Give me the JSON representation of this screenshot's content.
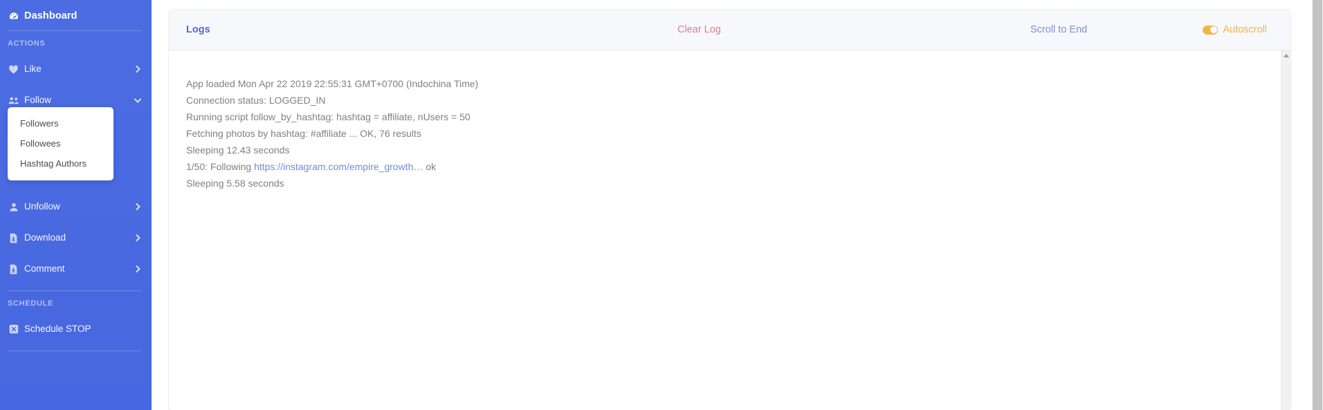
{
  "sidebar": {
    "brand": {
      "label": "Dashboard",
      "icon": "tachometer-icon"
    },
    "sections": [
      {
        "label": "ACTIONS"
      },
      {
        "label": "SCHEDULE"
      }
    ],
    "items": [
      {
        "label": "Like",
        "icon": "heart-icon",
        "chevron": "chevron-right-icon"
      },
      {
        "label": "Follow",
        "icon": "users-icon",
        "chevron": "chevron-down-icon"
      },
      {
        "label": "Unfollow",
        "icon": "user-icon",
        "chevron": "chevron-right-icon"
      },
      {
        "label": "Download",
        "icon": "file-download-icon",
        "chevron": "chevron-right-icon"
      },
      {
        "label": "Comment",
        "icon": "file-download-icon",
        "chevron": "chevron-right-icon"
      }
    ],
    "submenu": [
      {
        "label": "Followers"
      },
      {
        "label": "Followees"
      },
      {
        "label": "Hashtag Authors"
      }
    ],
    "schedule": {
      "label": "Schedule STOP",
      "icon": "x-square-icon"
    },
    "colors": {
      "background": "#4a6ae0",
      "text": "#ffffff"
    }
  },
  "header": {
    "title": "Logs",
    "clear_label": "Clear Log",
    "scroll_label": "Scroll to End",
    "autoscroll_label": "Autoscroll",
    "autoscroll_on": true,
    "colors": {
      "title": "#5068d8",
      "clear": "#e27a86",
      "scroll": "#7f8fc4",
      "autoscroll": "#efb54a"
    }
  },
  "log": {
    "lines": [
      {
        "text": "App loaded Mon Apr 22 2019 22:55:31 GMT+0700 (Indochina Time)"
      },
      {
        "text": "Connection status: LOGGED_IN"
      },
      {
        "text": "Running script follow_by_hashtag: hashtag = affiliate, nUsers = 50"
      },
      {
        "text": "Fetching photos by hashtag: #affiliate ... OK, 76 results"
      },
      {
        "text": "Sleeping 12.43 seconds"
      },
      {
        "prefix": "1/50: Following ",
        "link": "https://instagram.com/empire_growth…",
        "suffix": " ok"
      },
      {
        "text": "Sleeping 5.58 seconds"
      }
    ],
    "text_color": "#7f8085",
    "link_color": "#6c8ce0"
  }
}
